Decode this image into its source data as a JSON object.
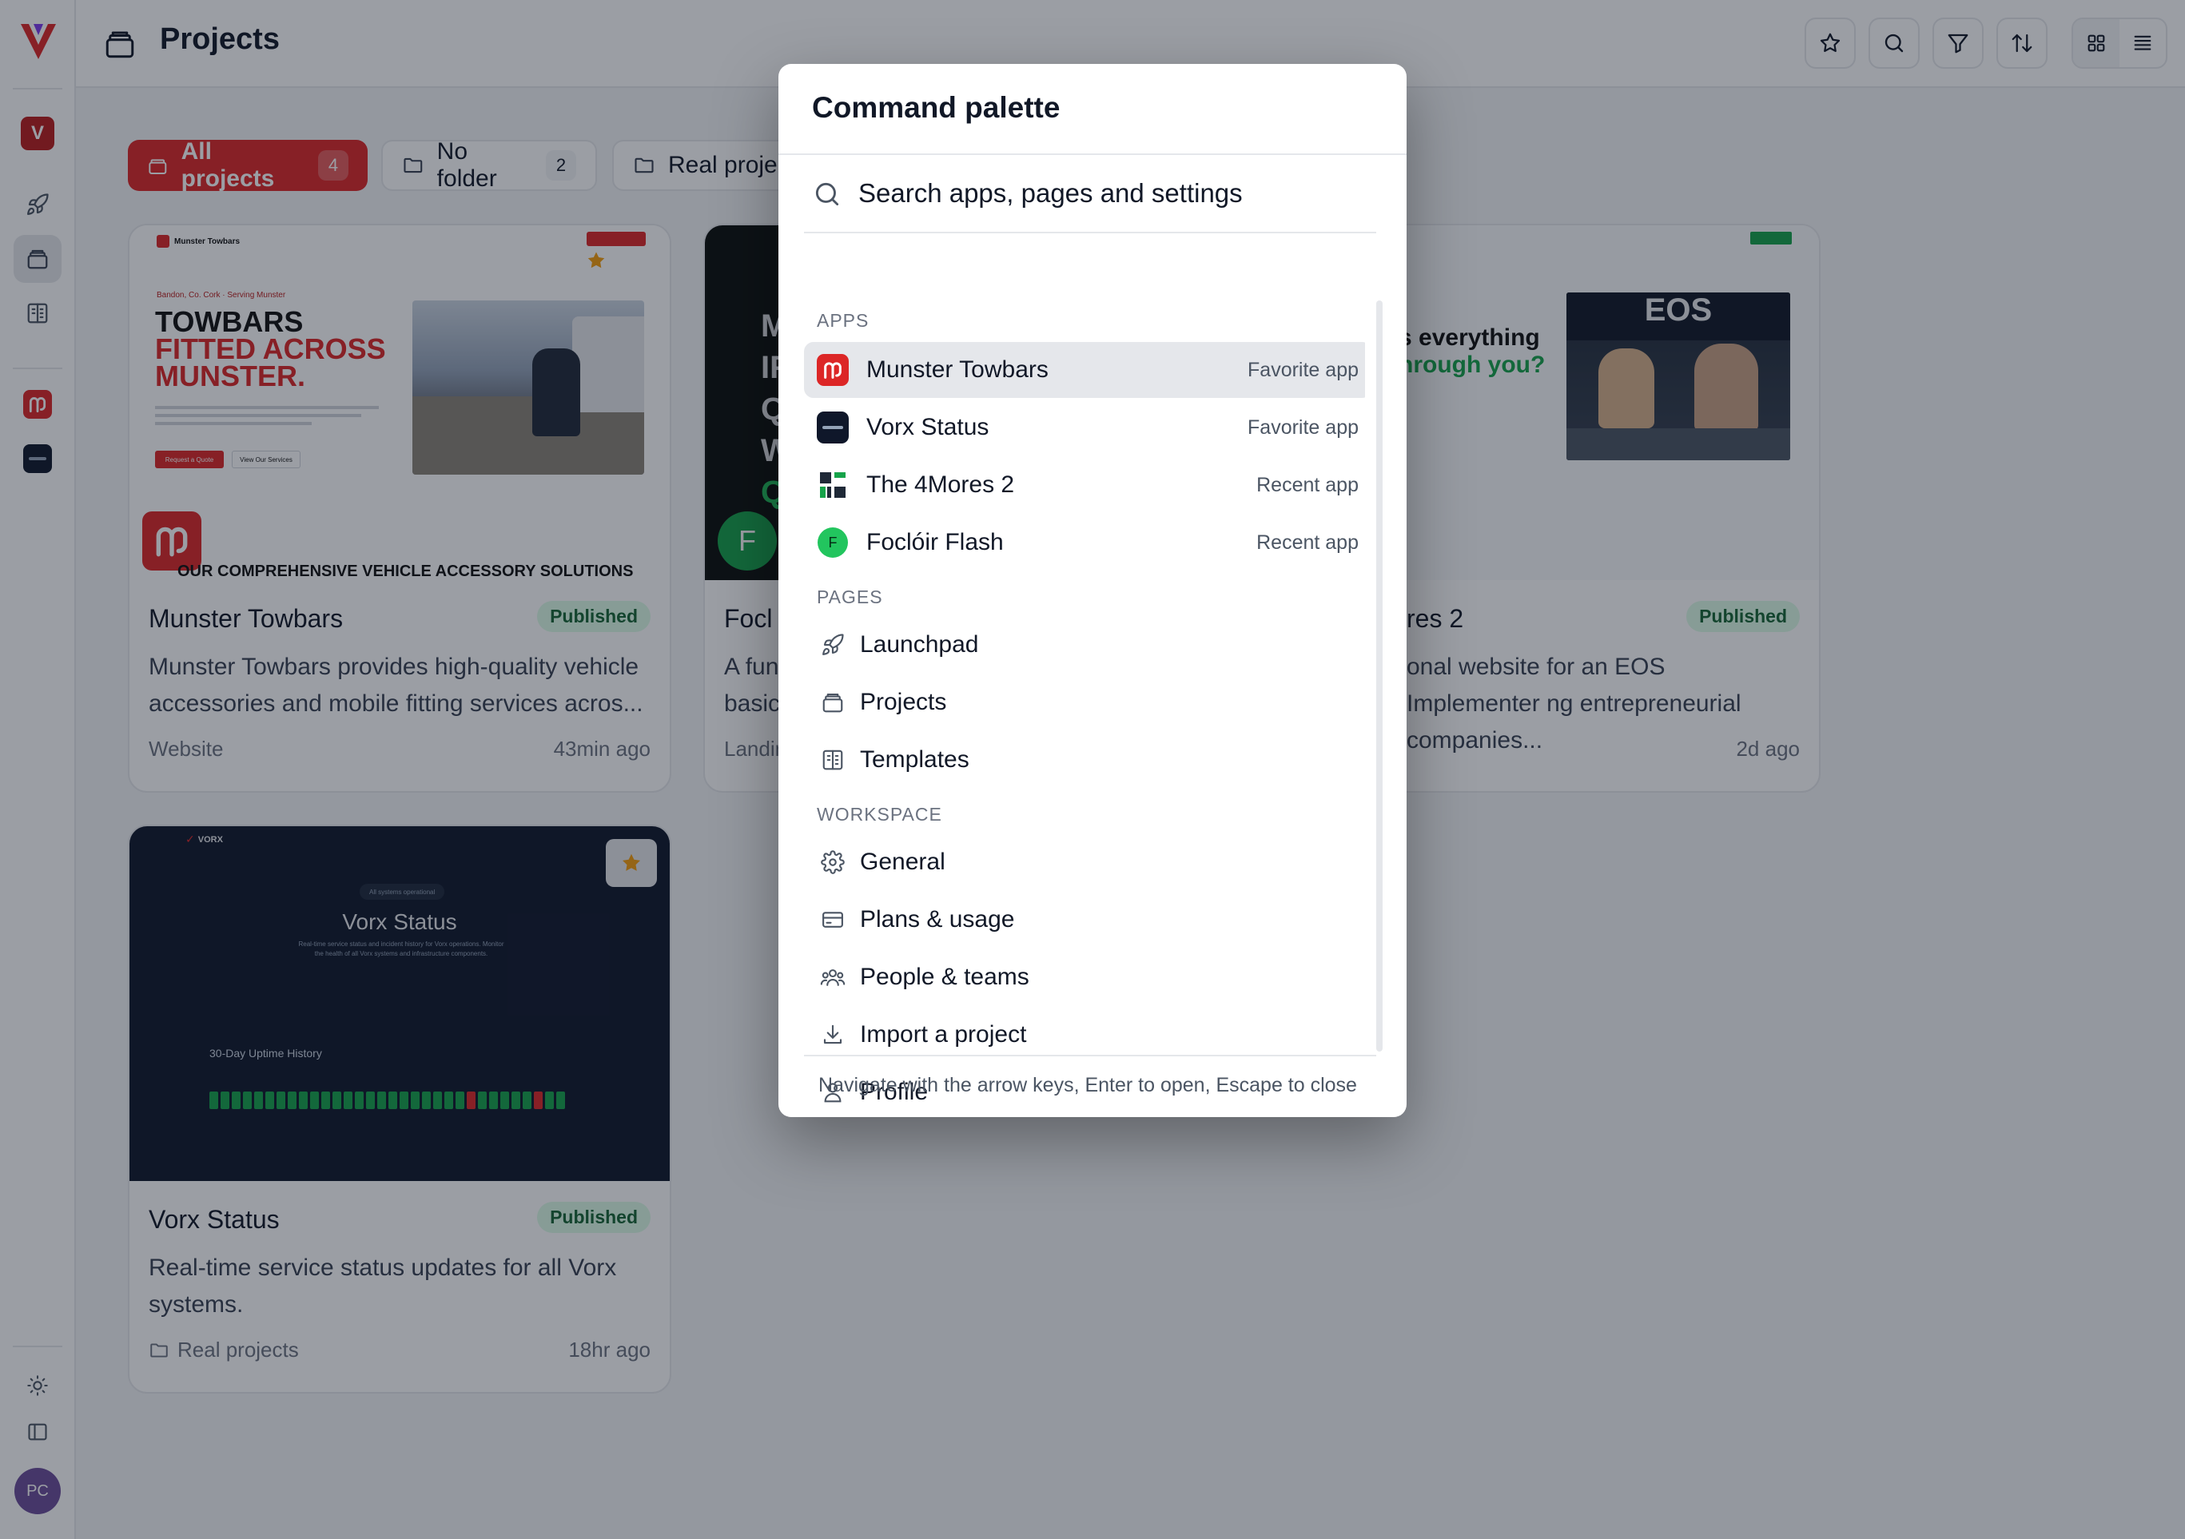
{
  "sidebar": {
    "workspace_initial": "V",
    "avatar_initials": "PC"
  },
  "header": {
    "title": "Projects"
  },
  "tabs": [
    {
      "label": "All projects",
      "count": "4"
    },
    {
      "label": "No folder",
      "count": "2"
    },
    {
      "label": "Real proje"
    }
  ],
  "cards": [
    {
      "title": "Munster Towbars",
      "status": "Published",
      "description": "Munster Towbars provides high-quality vehicle accessories and mobile fitting services acros...",
      "meta": "Website",
      "time": "43min ago",
      "thumb": {
        "brand": "Munster Towbars",
        "kicker": "Bandon, Co. Cork · Serving Munster",
        "headline_1": "TOWBARS",
        "headline_2": "FITTED ACROSS",
        "headline_3": "MUNSTER.",
        "cta_primary": "Request a Quote",
        "cta_secondary": "View Our Services",
        "strap": "OUR COMPREHENSIVE VEHICLE ACCESSORY SOLUTIONS"
      }
    },
    {
      "title": "Focl",
      "description": "A fun basic",
      "meta": "Landin",
      "thumb": {
        "avatar_letter": "F",
        "letters": [
          "M",
          "IF",
          "Q",
          "W",
          "Q"
        ]
      }
    },
    {
      "title": "res 2",
      "status": "Published",
      "description": "onal website for an EOS Implementer ng entrepreneurial companies...",
      "time": "2d ago",
      "thumb": {
        "headline_1": "s everything",
        "headline_2": "hrough you?",
        "photo_caption": "EOS"
      }
    },
    {
      "title": "Vorx Status",
      "status": "Published",
      "description": "Real-time service status updates for all Vorx systems.",
      "meta": "Real projects",
      "time": "18hr ago",
      "thumb": {
        "brand": "VORX",
        "pill": "All systems operational",
        "heading": "Vorx Status",
        "subtitle": "Real-time service status and incident history for Vorx operations. Monitor the health of all Vorx systems and infrastructure components.",
        "history_title": "30-Day Uptime History",
        "bars": [
          "g",
          "g",
          "g",
          "g",
          "g",
          "g",
          "g",
          "g",
          "g",
          "g",
          "g",
          "g",
          "g",
          "g",
          "g",
          "g",
          "g",
          "g",
          "g",
          "g",
          "g",
          "g",
          "g",
          "r",
          "g",
          "g",
          "g",
          "g",
          "g",
          "r",
          "g",
          "g"
        ]
      }
    }
  ],
  "palette": {
    "title": "Command palette",
    "search_placeholder": "Search apps, pages and settings",
    "sections": {
      "apps": "APPS",
      "pages": "PAGES",
      "workspace": "WORKSPACE"
    },
    "apps": [
      {
        "label": "Munster Towbars",
        "tag": "Favorite app",
        "icon": "munster-logo-icon"
      },
      {
        "label": "Vorx Status",
        "tag": "Favorite app",
        "icon": "vorx-logo-icon"
      },
      {
        "label": "The 4Mores 2",
        "tag": "Recent app",
        "icon": "4mores-logo-icon"
      },
      {
        "label": "Foclóir Flash",
        "tag": "Recent app",
        "icon": "foclóir-logo-icon",
        "letter": "F"
      }
    ],
    "pages": [
      {
        "label": "Launchpad",
        "icon": "rocket-icon"
      },
      {
        "label": "Projects",
        "icon": "folder-stack-icon"
      },
      {
        "label": "Templates",
        "icon": "template-icon"
      }
    ],
    "workspace": [
      {
        "label": "General",
        "icon": "gear-icon"
      },
      {
        "label": "Plans & usage",
        "icon": "credit-card-icon"
      },
      {
        "label": "People & teams",
        "icon": "people-icon"
      },
      {
        "label": "Import a project",
        "icon": "download-icon"
      },
      {
        "label": "Profile",
        "icon": "user-icon"
      }
    ],
    "footer": "Navigate with the arrow keys, Enter to open, Escape to close"
  },
  "colors": {
    "brand_red": "#dc2626",
    "published_bg": "#dcfce7",
    "published_fg": "#166534",
    "vorx_navy": "#0f172a"
  }
}
